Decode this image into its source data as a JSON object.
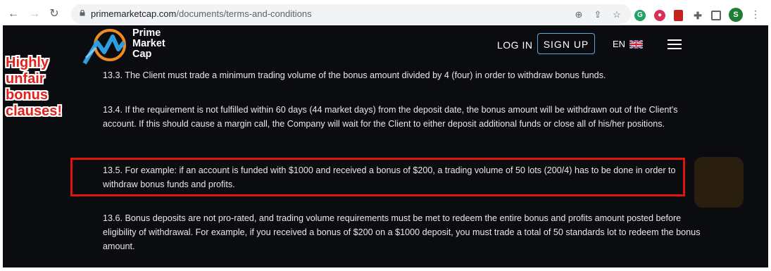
{
  "browser": {
    "url_host": "primemarketcap.com",
    "url_path": "/documents/terms-and-conditions",
    "profile_initial": "S"
  },
  "site": {
    "brand_line1": "Prime",
    "brand_line2": "Market",
    "brand_line3": "Cap",
    "login_label": "LOG IN",
    "signup_label": "SIGN UP",
    "language": "EN",
    "accent_color": "#3aa3e3"
  },
  "content": {
    "p13_3": "13.3. The Client must trade a minimum trading volume of the bonus amount divided by 4 (four) in order to withdraw bonus funds.",
    "p13_4": "13.4. If the requirement is not fulfilled within 60 days (44 market days) from the deposit date, the bonus amount will be withdrawn out of the Client's account. If this should cause a margin call, the Company will wait for the Client to either deposit additional funds or close all of his/her positions.",
    "p13_5": "13.5. For example: if an account is funded with $1000 and received a bonus of $200, a trading volume of 50 lots (200/4) has to be done in order to withdraw bonus funds and profits.",
    "p13_6": "13.6. Bonus deposits are not pro-rated, and trading volume requirements must be met to redeem the entire bonus and profits amount posted before eligibility of withdrawal. For example, if you received a bonus of $200 on a $1000 deposit, you must trade a total of 50 standards lot to redeem the bonus amount."
  },
  "annotation": {
    "line1": "Highly",
    "line2": "unfair",
    "line3": "bonus",
    "line4": "clauses!",
    "color": "#e1211c"
  }
}
